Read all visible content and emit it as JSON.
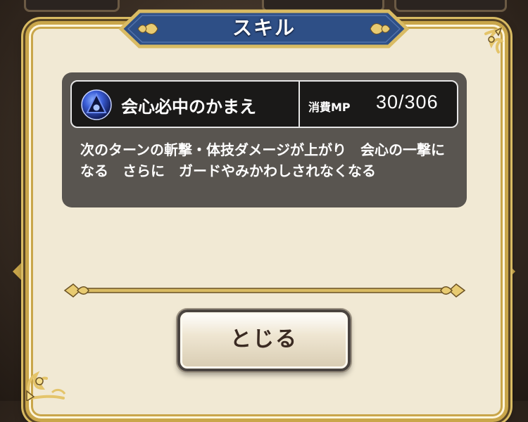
{
  "dialog": {
    "title": "スキル",
    "close_label": "とじる"
  },
  "skill": {
    "name": "会心必中のかまえ",
    "mp_label": "消費MP",
    "mp_value": "30/306",
    "description": "次のターンの斬撃・体技ダメージが上がり　会心の一撃になる　さらに　ガードやみかわしされなくなる",
    "icon": "blue-orb-skill-icon"
  },
  "colors": {
    "gold": "#c9a64a",
    "parchment": "#f1e9d4",
    "banner_blue": "#2e4f86",
    "panel_gray": "#595550"
  }
}
